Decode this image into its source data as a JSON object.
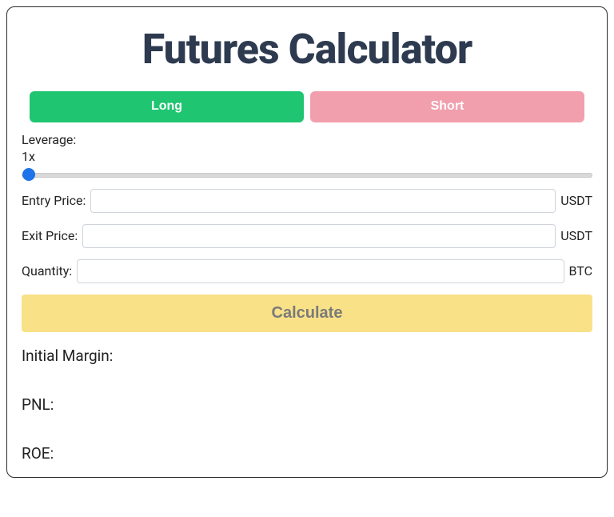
{
  "title": "Futures Calculator",
  "position": {
    "long_label": "Long",
    "short_label": "Short"
  },
  "leverage": {
    "label": "Leverage:",
    "value_display": "1x",
    "min": 1,
    "max": 125,
    "value": 1
  },
  "inputs": {
    "entry": {
      "label": "Entry Price:",
      "unit": "USDT",
      "value": ""
    },
    "exit": {
      "label": "Exit Price:",
      "unit": "USDT",
      "value": ""
    },
    "qty": {
      "label": "Quantity:",
      "unit": "BTC",
      "value": ""
    }
  },
  "calculate_label": "Calculate",
  "results": {
    "initial_margin_label": "Initial Margin:",
    "pnl_label": "PNL:",
    "roe_label": "ROE:"
  }
}
